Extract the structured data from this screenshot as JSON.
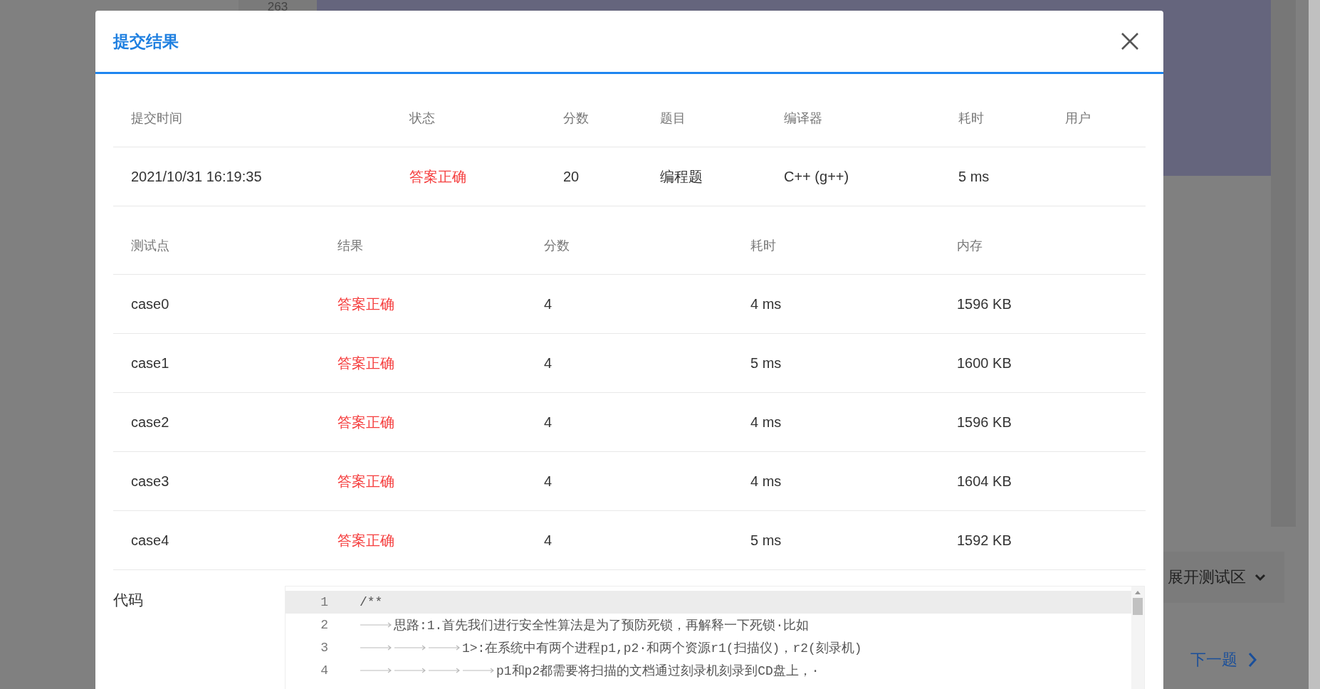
{
  "background": {
    "line_number": "263",
    "expand_label": "展开测试区",
    "next_label": "下一题"
  },
  "dialog": {
    "title": "提交结果"
  },
  "submission": {
    "columns": [
      "提交时间",
      "状态",
      "分数",
      "题目",
      "编译器",
      "耗时",
      "用户"
    ],
    "row": {
      "time": "2021/10/31 16:19:35",
      "status": "答案正确",
      "score": "20",
      "problem": "编程题",
      "compiler": "C++ (g++)",
      "duration": "5 ms"
    }
  },
  "tests": {
    "columns": [
      "测试点",
      "结果",
      "分数",
      "耗时",
      "内存"
    ],
    "rows": [
      {
        "case": "case0",
        "result": "答案正确",
        "score": "4",
        "time": "4 ms",
        "memory": "1596 KB"
      },
      {
        "case": "case1",
        "result": "答案正确",
        "score": "4",
        "time": "5 ms",
        "memory": "1600 KB"
      },
      {
        "case": "case2",
        "result": "答案正确",
        "score": "4",
        "time": "4 ms",
        "memory": "1596 KB"
      },
      {
        "case": "case3",
        "result": "答案正确",
        "score": "4",
        "time": "4 ms",
        "memory": "1604 KB"
      },
      {
        "case": "case4",
        "result": "答案正确",
        "score": "4",
        "time": "5 ms",
        "memory": "1592 KB"
      }
    ]
  },
  "code": {
    "label": "代码",
    "lines": [
      {
        "number": "1",
        "text": "/**",
        "current": true
      },
      {
        "number": "2",
        "text": "思路:1.首先我们进行安全性算法是为了预防死锁，再解释一下死锁·比如",
        "current": false
      },
      {
        "number": "3",
        "text": "1>:在系统中有两个进程p1,p2·和两个资源r1(扫描仪)，r2(刻录机)",
        "current": false
      },
      {
        "number": "4",
        "text": "p1和p2都需要将扫描的文档通过刻录机刻录到CD盘上，·",
        "current": false
      }
    ]
  }
}
